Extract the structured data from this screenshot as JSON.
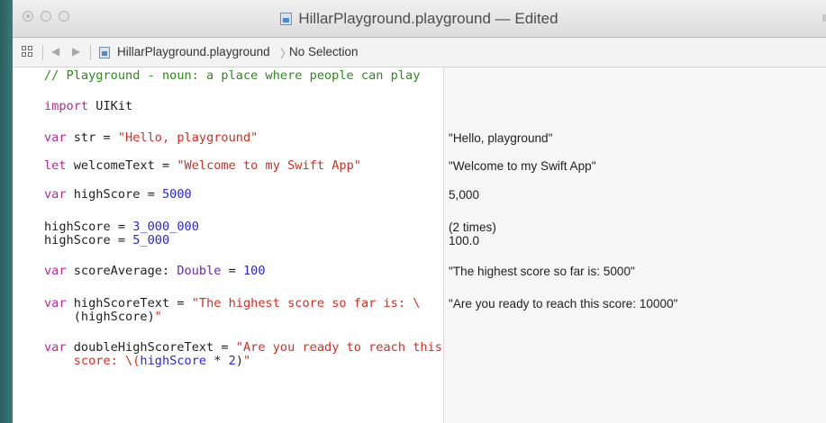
{
  "window": {
    "title": "HillarPlayground.playground — Edited"
  },
  "navbar": {
    "breadcrumb_file": "HillarPlayground.playground",
    "breadcrumb_selection": "No Selection"
  },
  "code": {
    "comment": "// Playground - noun: a place where people can play",
    "import_kw": "import",
    "import_mod": " UIKit",
    "str_kw": "var",
    "str_decl": " str = ",
    "str_val": "\"Hello, playground\"",
    "welcome_kw": "let",
    "welcome_decl": " welcomeText = ",
    "welcome_val": "\"Welcome to my Swift App\"",
    "hs_kw": "var",
    "hs_decl": " highScore = ",
    "hs_val": "5000",
    "assign1_decl": "highScore = ",
    "assign1_val": "3_000_000",
    "assign2_decl": "highScore = ",
    "assign2_val": "5_000",
    "avg_kw": "var",
    "avg_decl": " scoreAverage: ",
    "avg_type": "Double",
    "avg_eq": " = ",
    "avg_val": "100",
    "hst_kw": "var",
    "hst_decl": " highScoreText = ",
    "hst_val1": "\"The highest score so far is: \\",
    "hst_indent": "    (highScore)",
    "hst_close": "\"",
    "dhst_kw": "var",
    "dhst_decl": " doubleHighScoreText = ",
    "dhst_val1": "\"Are you ready to reach this",
    "dhst_indent": "    score: \\(",
    "dhst_ident": "highScore",
    "dhst_op": " * ",
    "dhst_num": "2",
    "dhst_paren": ")",
    "dhst_close": "\""
  },
  "results": {
    "str": "\"Hello, playground\"",
    "welcome": "\"Welcome to my Swift App\"",
    "highScore": "5,000",
    "assign_times": "(2 times)",
    "avg": "100.0",
    "hst": "\"The highest score so far is: 5000\"",
    "dhst": "\"Are you ready to reach this score: 10000\""
  }
}
